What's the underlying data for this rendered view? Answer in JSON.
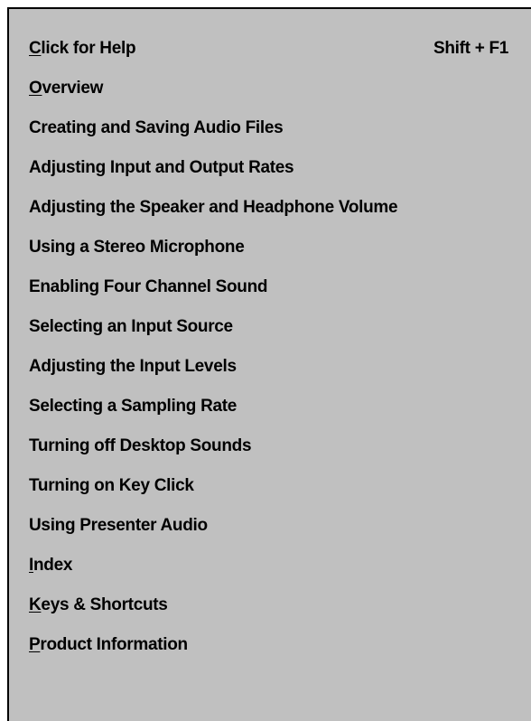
{
  "menu": {
    "items": [
      {
        "label": "Click for Help",
        "mnemonic": "C",
        "rest": "lick for Help",
        "shortcut": "Shift + F1"
      },
      {
        "label": "Overview",
        "mnemonic": "O",
        "rest": "verview"
      },
      {
        "label": "Creating and Saving Audio Files"
      },
      {
        "label": "Adjusting Input and Output Rates"
      },
      {
        "label": "Adjusting the Speaker and Headphone Volume"
      },
      {
        "label": "Using a Stereo Microphone"
      },
      {
        "label": "Enabling Four Channel Sound"
      },
      {
        "label": "Selecting an Input Source"
      },
      {
        "label": "Adjusting the Input Levels"
      },
      {
        "label": "Selecting a Sampling Rate"
      },
      {
        "label": "Turning off Desktop Sounds"
      },
      {
        "label": "Turning on Key Click"
      },
      {
        "label": "Using Presenter Audio"
      },
      {
        "label": "Index",
        "mnemonic": "I",
        "rest": "ndex"
      },
      {
        "label": "Keys & Shortcuts",
        "mnemonic": "K",
        "rest": "eys & Shortcuts"
      },
      {
        "label": "Product Information",
        "mnemonic": "P",
        "rest": "roduct Information"
      }
    ]
  },
  "colors": {
    "menu_background": "#c0c0c0",
    "page_background": "#ffffff",
    "text": "#000000"
  }
}
